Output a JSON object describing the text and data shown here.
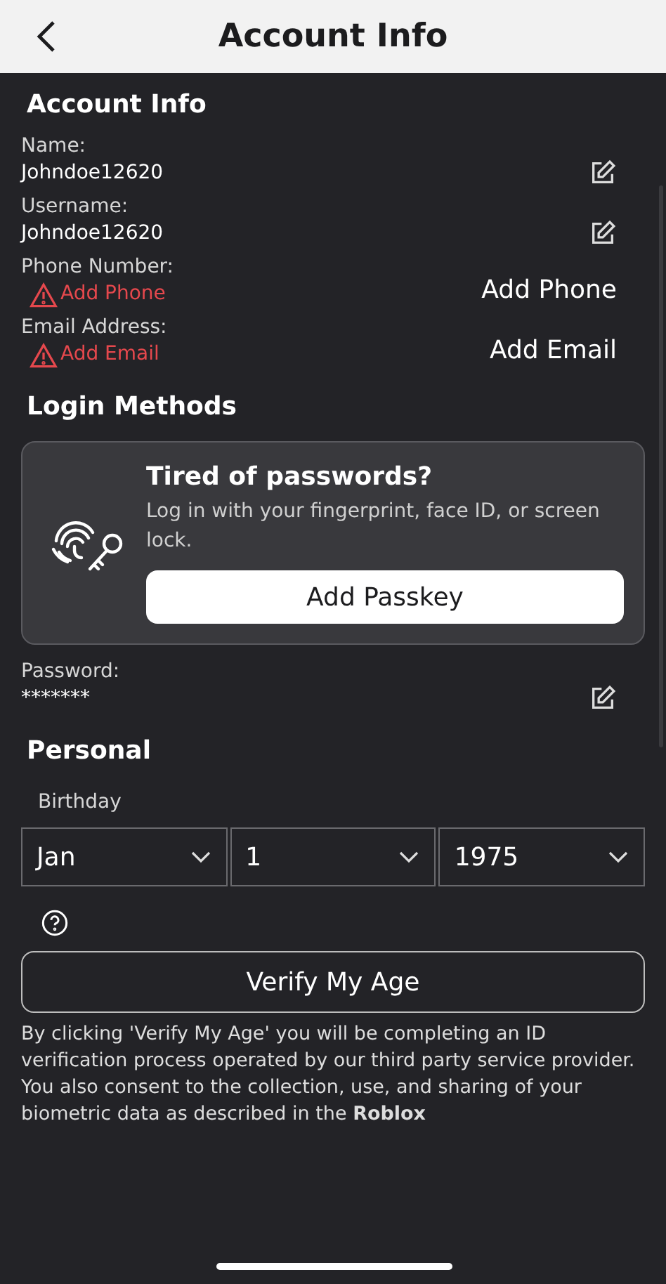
{
  "header": {
    "title": "Account Info"
  },
  "account_info": {
    "heading": "Account Info",
    "fields": [
      {
        "kind": "edit",
        "label": "Name:",
        "value": "Johndoe12620"
      },
      {
        "kind": "edit",
        "label": "Username:",
        "value": "Johndoe12620"
      },
      {
        "kind": "add",
        "label": "Phone Number:",
        "warning": "Add Phone",
        "action": "Add Phone"
      },
      {
        "kind": "add",
        "label": "Email Address:",
        "warning": "Add Email",
        "action": "Add Email"
      }
    ]
  },
  "login_methods": {
    "heading": "Login Methods",
    "passkey_card": {
      "title": "Tired of passwords?",
      "text": "Log in with your fingerprint, face ID, or screen lock.",
      "button": "Add Passkey"
    },
    "fields": [
      {
        "kind": "edit",
        "label": "Password:",
        "value": "*******"
      }
    ]
  },
  "personal": {
    "heading": "Personal",
    "birthday": {
      "label": "Birthday",
      "selects": [
        "Jan",
        "1",
        "1975"
      ]
    },
    "verify_button": "Verify My Age",
    "disclaimer": "By clicking 'Verify My Age' you will be completing an ID verification process operated by our third party service provider. You also consent to the collection, use, and sharing of your biometric data as described in the **Roblox**"
  }
}
